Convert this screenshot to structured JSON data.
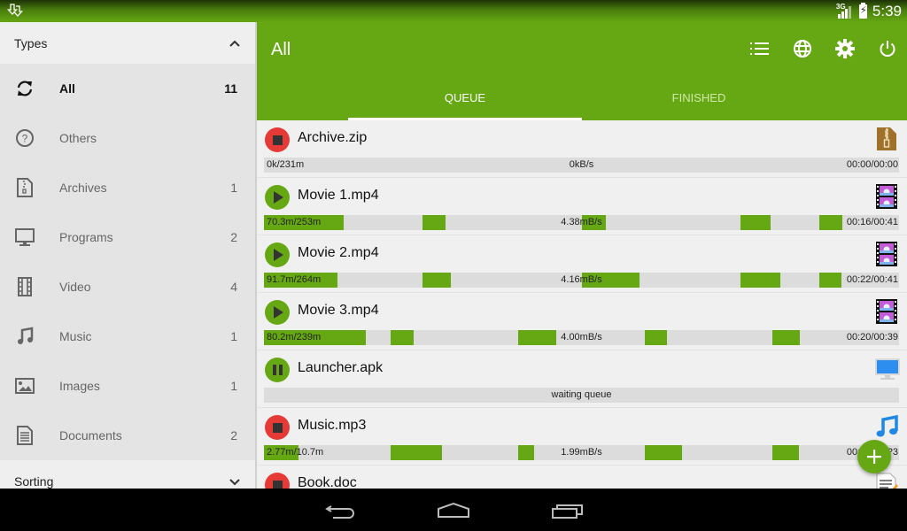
{
  "status_bar": {
    "notification_icon": "download-icon",
    "network_type": "3G",
    "signal_icon": "signal-icon",
    "battery_icon": "battery-charging-icon",
    "time": "5:39"
  },
  "sidebar": {
    "types_header": "Types",
    "types_expanded": true,
    "items": [
      {
        "label": "All",
        "count": "11",
        "icon": "sync-icon",
        "active": true
      },
      {
        "label": "Others",
        "count": "",
        "icon": "question-circle-icon",
        "active": false
      },
      {
        "label": "Archives",
        "count": "1",
        "icon": "archive-file-icon",
        "active": false
      },
      {
        "label": "Programs",
        "count": "2",
        "icon": "monitor-icon",
        "active": false
      },
      {
        "label": "Video",
        "count": "4",
        "icon": "film-icon",
        "active": false
      },
      {
        "label": "Music",
        "count": "1",
        "icon": "music-note-icon",
        "active": false
      },
      {
        "label": "Images",
        "count": "1",
        "icon": "image-icon",
        "active": false
      },
      {
        "label": "Documents",
        "count": "2",
        "icon": "document-icon",
        "active": false
      }
    ],
    "sorting_header": "Sorting",
    "sorting_expanded": false
  },
  "appbar": {
    "title": "All",
    "actions": [
      "list-icon",
      "globe-icon",
      "settings-icon",
      "power-icon"
    ],
    "tabs": [
      {
        "label": "QUEUE",
        "active": true
      },
      {
        "label": "FINISHED",
        "active": false
      }
    ]
  },
  "downloads": [
    {
      "name": "Archive.zip",
      "state": "stopped",
      "type_icon": "zip-file-icon",
      "size": "0k/231m",
      "speed": "0kB/s",
      "time": "00:00/00:00",
      "threads": 8,
      "segments": [
        0,
        0,
        0,
        0,
        0,
        0,
        0,
        0
      ]
    },
    {
      "name": "Movie 1.mp4",
      "state": "downloading",
      "type_icon": "video-file-icon",
      "size": "70.3m/253m",
      "speed": "4.38mB/s",
      "time": "00:16/00:41",
      "threads": 8,
      "segments": [
        1.0,
        0,
        0.29,
        0,
        0.31,
        0,
        0.38,
        0.29
      ]
    },
    {
      "name": "Movie 2.mp4",
      "state": "downloading",
      "type_icon": "video-file-icon",
      "size": "91.7m/264m",
      "speed": "4.16mB/s",
      "time": "00:22/00:41",
      "threads": 8,
      "segments": [
        0.93,
        0,
        0.35,
        0,
        0.73,
        0,
        0.51,
        0.27
      ]
    },
    {
      "name": "Movie 3.mp4",
      "state": "downloading",
      "type_icon": "video-file-icon",
      "size": "80.2m/239m",
      "speed": "4.00mB/s",
      "time": "00:20/00:39",
      "threads": 5,
      "segments": [
        0.8,
        0.18,
        0.3,
        0.17,
        0.22
      ]
    },
    {
      "name": "Launcher.apk",
      "state": "paused",
      "type_icon": "program-file-icon",
      "status": "waiting queue"
    },
    {
      "name": "Music.mp3",
      "state": "stopped",
      "type_icon": "music-file-icon",
      "size": "2.77m/10.7m",
      "speed": "1.99mB/s",
      "time": "00:0?/00:?3",
      "threads": 5,
      "segments": [
        0.27,
        0.4,
        0.13,
        0.29,
        0.21
      ]
    },
    {
      "name": "Book.doc",
      "state": "stopped",
      "type_icon": "document-file-icon"
    }
  ],
  "fab": {
    "icon": "plus-icon",
    "label": "Add download"
  },
  "nav_bar": {
    "buttons": [
      "back-icon",
      "home-icon",
      "recent-apps-icon"
    ]
  },
  "colors": {
    "accent": "#66a813",
    "stop": "#e53a35",
    "bar_bg": "#dcdcdc"
  }
}
